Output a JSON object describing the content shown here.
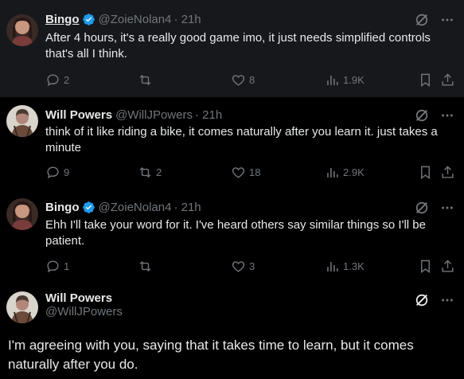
{
  "tweets": [
    {
      "name": "Bingo",
      "verified": true,
      "handle": "@ZoieNolan4",
      "time": "· 21h",
      "text": "After 4 hours, it's a really good game imo, it just needs simplified controls that's all I think.",
      "replies": "2",
      "reposts": "",
      "likes": "8",
      "views": "1.9K"
    },
    {
      "name": "Will Powers",
      "verified": false,
      "handle": "@WillJPowers",
      "time": "· 21h",
      "text": "think of it like riding a bike, it comes naturally after you learn it. just takes a minute",
      "replies": "9",
      "reposts": "2",
      "likes": "18",
      "views": "2.9K"
    },
    {
      "name": "Bingo",
      "verified": true,
      "handle": "@ZoieNolan4",
      "time": "· 21h",
      "text": "Ehh I'll take your word for it. I've heard others say similar things so I'll be patient.",
      "replies": "1",
      "reposts": "",
      "likes": "3",
      "views": "1.3K"
    }
  ],
  "main_tweet": {
    "name": "Will Powers",
    "handle": "@WillJPowers",
    "text": "I'm agreeing with you, saying that it takes time to learn, but it comes naturally after you do."
  },
  "colors": {
    "background": "#000000",
    "highlight_bg": "#16181c",
    "text": "#e7e9ea",
    "muted": "#71767b",
    "verified": "#1d9bf0"
  },
  "icons": [
    "reply-icon",
    "repost-icon",
    "like-icon",
    "views-icon",
    "bookmark-icon",
    "share-icon",
    "grok-icon",
    "more-icon",
    "verified-icon"
  ]
}
